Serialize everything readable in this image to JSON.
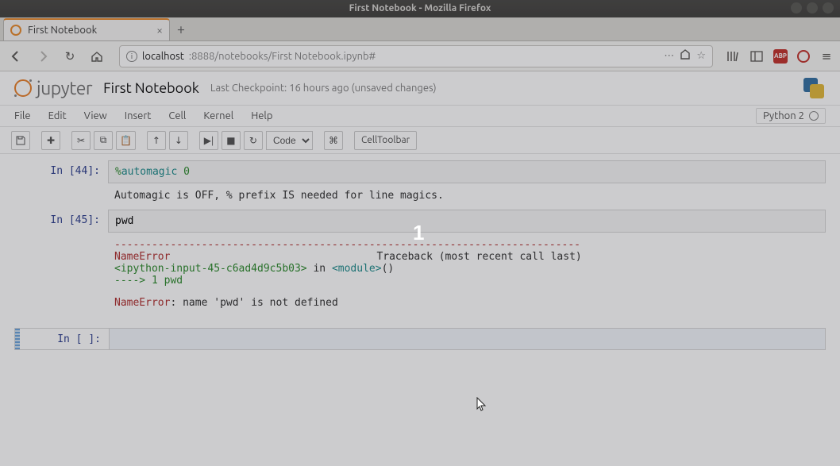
{
  "window": {
    "title": "First Notebook - Mozilla Firefox"
  },
  "tab": {
    "title": "First Notebook"
  },
  "url": {
    "host": "localhost",
    "rest": ":8888/notebooks/First Notebook.ipynb#"
  },
  "jupyter": {
    "logo_text": "jupyter",
    "notebook_name": "First Notebook",
    "checkpoint": "Last Checkpoint: 16 hours ago (unsaved changes)",
    "menus": [
      "File",
      "Edit",
      "View",
      "Insert",
      "Cell",
      "Kernel",
      "Help"
    ],
    "kernel_name": "Python 2",
    "cell_type": "Code",
    "celltoolbar_label": "CellToolbar"
  },
  "cells": [
    {
      "prompt": "In [44]:",
      "code_pct": "%",
      "code_word": "automagic",
      "code_arg": "0",
      "output_text": "Automagic is OFF, % prefix IS needed for line magics."
    },
    {
      "prompt": "In [45]:",
      "code": "pwd",
      "trace_dashes": "---------------------------------------------------------------------------",
      "trace_err1": "NameError",
      "trace_right": "Traceback (most recent call last)",
      "trace_l2_a": "<ipython-input-45-c6ad4d9c5b03>",
      "trace_l2_b": " in ",
      "trace_l2_c": "<module>",
      "trace_l2_d": "()",
      "trace_l3": "----> 1 pwd",
      "trace_l5a": "NameError",
      "trace_l5b": ": ",
      "trace_l5c": "name 'pwd' is not defined"
    },
    {
      "prompt": "In [ ]:"
    }
  ],
  "overlay_number": "1",
  "abp_label": "ABP",
  "chart_data": {
    "type": "table",
    "title": "",
    "categories": [],
    "values": []
  }
}
